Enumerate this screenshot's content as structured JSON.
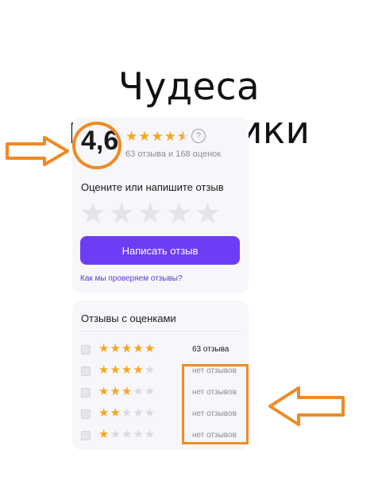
{
  "heading": "Чудеса математики",
  "rating": {
    "score": "4,6",
    "stars_level": 4.6,
    "help_icon": "question-circle-icon",
    "counts_text": "63 отзыва и 168 оценок"
  },
  "rate_prompt": "Оцените или напишите отзыв",
  "write_button": "Написать отзыв",
  "check_link": "Как мы проверяем отзывы?",
  "reviews": {
    "title": "Отзывы с оценками",
    "rows": [
      {
        "stars": 5,
        "count": "63 отзыва"
      },
      {
        "stars": 4,
        "count": "нет отзывов"
      },
      {
        "stars": 3,
        "count": "нет отзывов"
      },
      {
        "stars": 2,
        "count": "нет отзывов"
      },
      {
        "stars": 1,
        "count": "нет отзывов"
      }
    ]
  },
  "colors": {
    "accent": "#6d3cf5",
    "star": "#f8a51d",
    "annotation": "#f08a24"
  }
}
